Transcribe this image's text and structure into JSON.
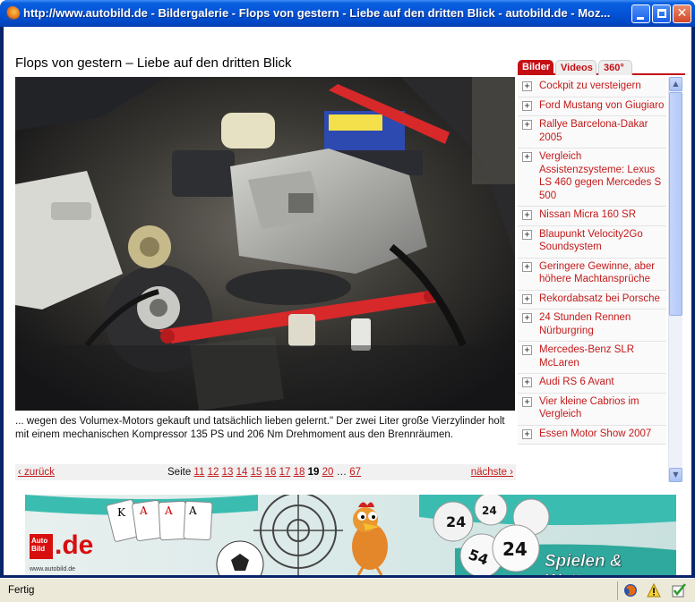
{
  "window": {
    "title": "http://www.autobild.de - Bildergalerie - Flops von gestern - Liebe auf den dritten Blick - autobild.de - Moz...",
    "buttons": {
      "minimize": "",
      "maximize": "",
      "close": "✕"
    }
  },
  "page": {
    "title": "Flops von gestern – Liebe auf den dritten Blick",
    "caption": "... wegen des Volumex-Motors gekauft und tatsächlich lieben gelernt.\" Der zwei Liter große Vierzylinder holt mit einem mechanischen Kompressor 135 PS und 206 Nm Drehmoment aus den Brennräumen.",
    "pager": {
      "prev": "‹ zurück",
      "next": "nächste ›",
      "label": "Seite",
      "pages": [
        "11",
        "12",
        "13",
        "14",
        "15",
        "16",
        "17",
        "18",
        "19",
        "20"
      ],
      "current": "19",
      "ellipsis": "…",
      "last": "67"
    }
  },
  "sidebar": {
    "tabs": [
      {
        "label": "Bilder",
        "active": true
      },
      {
        "label": "Videos",
        "active": false
      },
      {
        "label": "360°",
        "active": false
      }
    ],
    "items": [
      "Cockpit zu versteigern",
      "Ford Mustang von Giugiaro",
      "Rallye Barcelona-Dakar 2005",
      "Vergleich Assistenzsysteme: Lexus LS 460 gegen Mercedes S 500",
      "Nissan Micra 160 SR",
      "Blaupunkt Velocity2Go Soundsystem",
      "Geringere Gewinne, aber höhere Machtansprüche",
      "Rekordabsatz bei Porsche",
      "24 Stunden Rennen Nürburgring",
      "Mercedes-Benz SLR McLaren",
      "Audi RS 6 Avant",
      "Vier kleine Cabrios im Vergleich",
      "Essen Motor Show 2007"
    ]
  },
  "ad": {
    "logo_top": "Auto",
    "logo_bottom": "Bild",
    "logo_tld": ".de",
    "url": "www.autobild.de",
    "slogan": "Spielen & Wetten",
    "ball_numbers": [
      "24",
      "24",
      "54",
      "24"
    ]
  },
  "status": {
    "text": "Fertig"
  },
  "colors": {
    "accent": "#c40f14",
    "link": "#c41a1a",
    "titlebar": "#0453d6"
  }
}
